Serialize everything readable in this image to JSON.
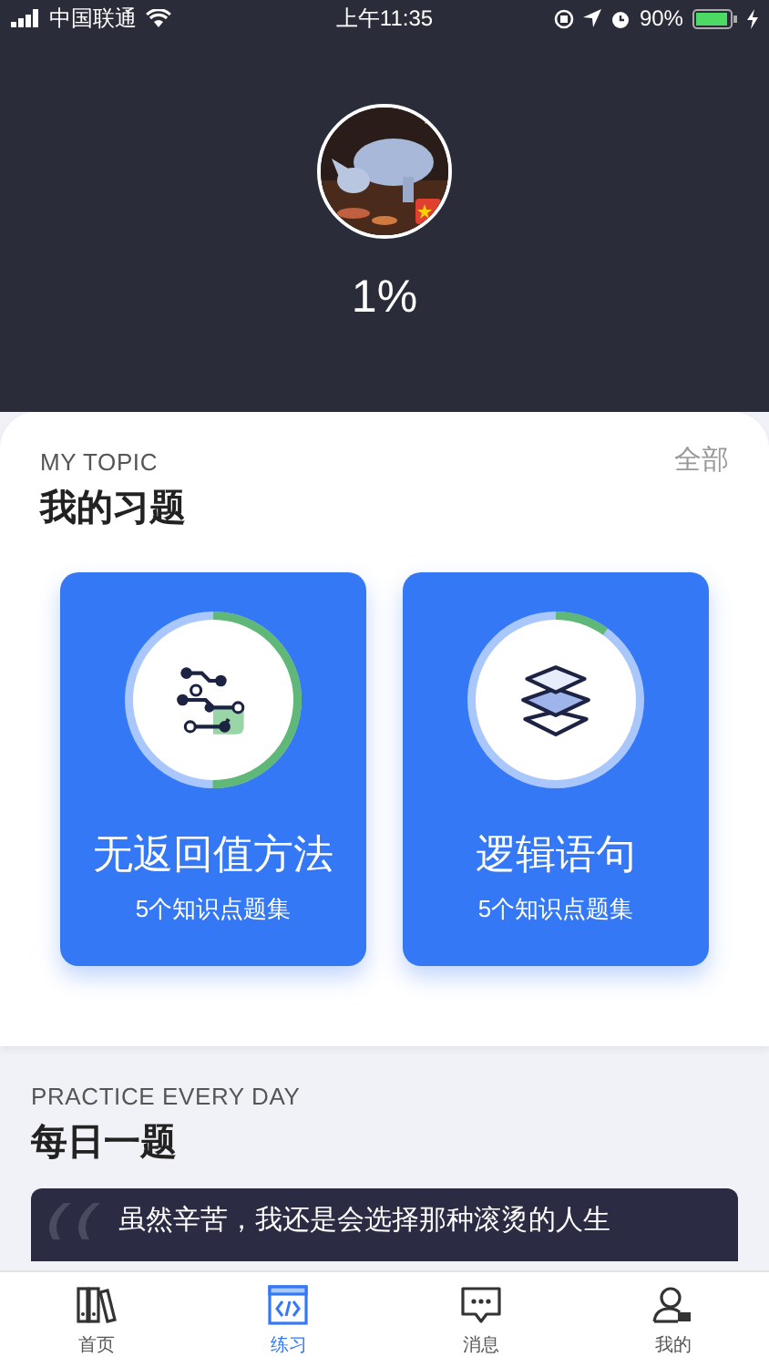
{
  "status_bar": {
    "carrier": "中国联通",
    "time": "上午11:35",
    "battery": "90%"
  },
  "profile": {
    "progress": "1%"
  },
  "my_topic": {
    "subtitle": "MY TOPIC",
    "title": "我的习题",
    "more": "全部",
    "cards": [
      {
        "kind": "circuit",
        "title": "无返回值方法",
        "count": "5个知识点题集"
      },
      {
        "kind": "layers",
        "title": "逻辑语句",
        "count": "5个知识点题集"
      }
    ]
  },
  "daily": {
    "subtitle": "PRACTICE EVERY DAY",
    "title": "每日一题",
    "quote": "虽然辛苦，我还是会选择那种滚烫的人生"
  },
  "tab_bar": [
    {
      "kind": "books",
      "label": "首页",
      "selected": false
    },
    {
      "kind": "code",
      "label": "练习",
      "selected": true
    },
    {
      "kind": "chat",
      "label": "消息",
      "selected": false
    },
    {
      "kind": "user",
      "label": "我的",
      "selected": false
    }
  ]
}
